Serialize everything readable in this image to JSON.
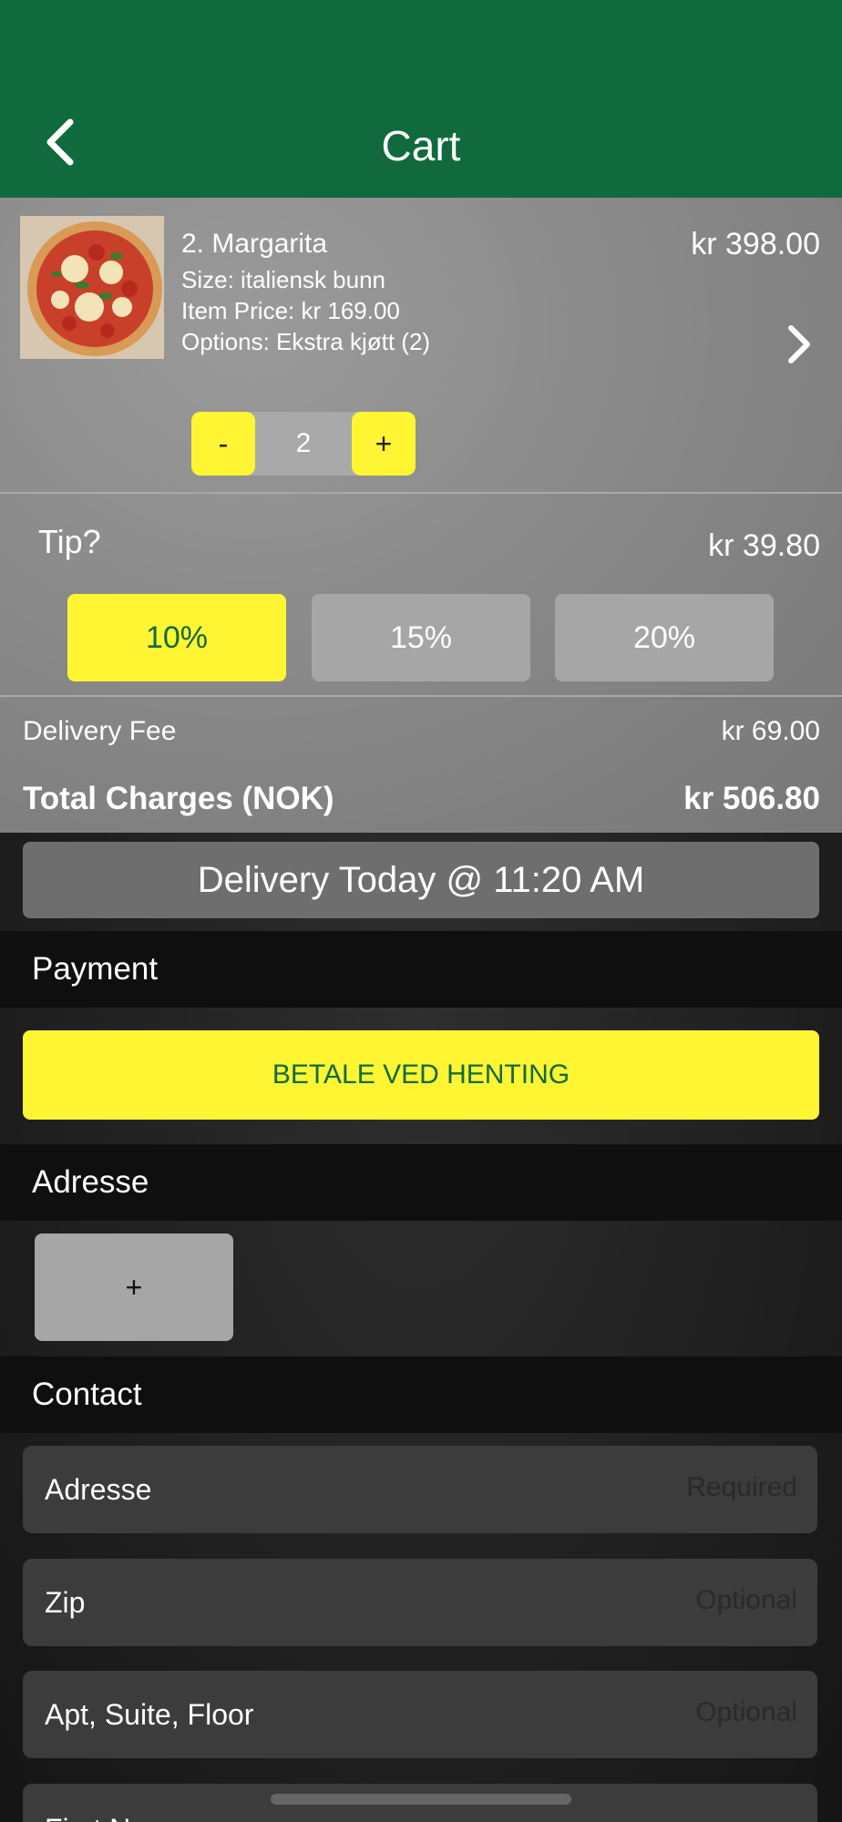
{
  "header": {
    "title": "Cart",
    "background_color": "#116a3d",
    "back_icon": "chevron-left-icon"
  },
  "cart_item": {
    "name": "2. Margarita",
    "size": "Size: italiensk bunn",
    "item_price": "Item Price: kr 169.00",
    "options": "Options: Ekstra kjøtt  (2)",
    "total_price": "kr 398.00",
    "image": "pizza-image",
    "detail_icon": "chevron-right-icon",
    "quantity": {
      "minus_label": "-",
      "value": "2",
      "plus_label": "+"
    }
  },
  "tip": {
    "label": "Tip?",
    "amount": "kr 39.80",
    "options": [
      "10%",
      "15%",
      "20%"
    ],
    "selected": "10%"
  },
  "charges": {
    "delivery_fee_label": "Delivery Fee",
    "delivery_fee_value": "kr 69.00",
    "total_label": "Total Charges (NOK)",
    "total_value": "kr 506.80"
  },
  "delivery_time_button": "Delivery Today @ 11:20 AM",
  "payment": {
    "section_title": "Payment",
    "method_button": "BETALE VED HENTING"
  },
  "address": {
    "section_title": "Adresse",
    "add_button": "+"
  },
  "contact": {
    "section_title": "Contact",
    "fields": [
      {
        "label": "Adresse",
        "placeholder": "Required"
      },
      {
        "label": "Zip",
        "placeholder": "Optional"
      },
      {
        "label": "Apt, Suite, Floor",
        "placeholder": "Optional"
      },
      {
        "label": "First N",
        "placeholder": "..."
      }
    ]
  },
  "colors": {
    "accent_yellow": "#fff533",
    "brand_green": "#116a3d"
  }
}
